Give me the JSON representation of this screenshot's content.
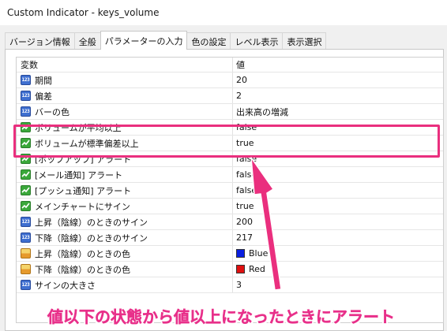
{
  "window": {
    "title": "Custom Indicator - keys_volume"
  },
  "tabs": [
    {
      "label": "バージョン情報"
    },
    {
      "label": "全般"
    },
    {
      "label": "パラメーターの入力"
    },
    {
      "label": "色の設定"
    },
    {
      "label": "レベル表示"
    },
    {
      "label": "表示選択"
    }
  ],
  "active_tab": "パラメーターの入力",
  "grid": {
    "headers": {
      "variable": "変数",
      "value": "値"
    },
    "rows": [
      {
        "icon": "number-123-icon",
        "name": "期間",
        "value": "20"
      },
      {
        "icon": "number-123-icon",
        "name": "偏差",
        "value": "2"
      },
      {
        "icon": "number-123-icon",
        "name": "バーの色",
        "value": "出来高の増減"
      },
      {
        "icon": "boolean-icon",
        "name": "ボリュームが平均以上",
        "value": "false"
      },
      {
        "icon": "boolean-icon",
        "name": "ボリュームが標準偏差以上",
        "value": "true"
      },
      {
        "icon": "boolean-icon",
        "name": "[ポップアップ] アラート",
        "value": "false"
      },
      {
        "icon": "boolean-icon",
        "name": "[メール通知] アラート",
        "value": "false"
      },
      {
        "icon": "boolean-icon",
        "name": "[プッシュ通知] アラート",
        "value": "false"
      },
      {
        "icon": "boolean-icon",
        "name": "メインチャートにサイン",
        "value": "true"
      },
      {
        "icon": "number-123-icon",
        "name": "上昇（陰線）のときのサイン",
        "value": "200"
      },
      {
        "icon": "number-123-icon",
        "name": "下降（陰線）のときのサイン",
        "value": "217"
      },
      {
        "icon": "color-icon",
        "name": "上昇（陰線）のときの色",
        "value": "Blue",
        "swatch": "#0a1fe0"
      },
      {
        "icon": "color-icon",
        "name": "下降（陰線）のときの色",
        "value": "Red",
        "swatch": "#e01010"
      },
      {
        "icon": "number-123-icon",
        "name": "サインの大きさ",
        "value": "3"
      }
    ]
  },
  "annotation": {
    "caption": "値以下の状態から値以上になったときにアラート",
    "color": "#e8308a"
  },
  "colors": {
    "accent_pink": "#ea2f7e",
    "number_icon_blue": "#3f6fd0",
    "boolean_icon_green": "#3aa83a"
  }
}
